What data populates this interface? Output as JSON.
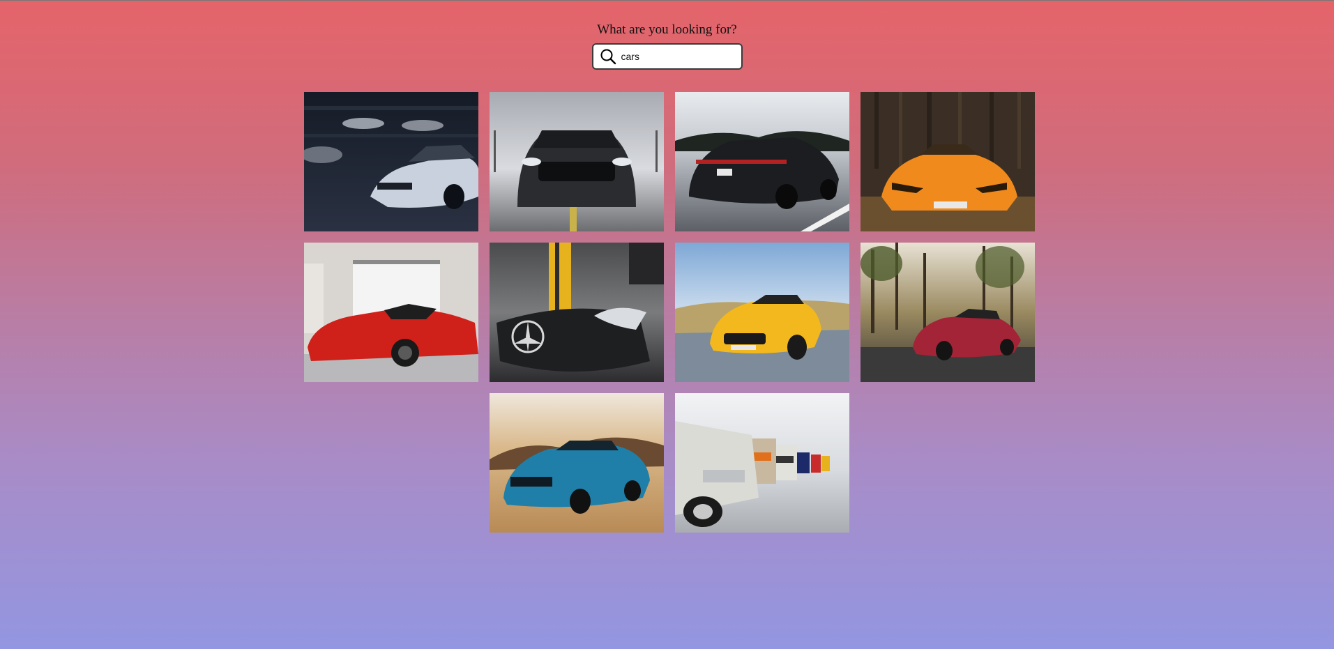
{
  "search": {
    "prompt": "What are you looking for?",
    "value": "cars",
    "icon": "search-icon"
  },
  "results": [
    {
      "subject": "silver-camaro-garage",
      "colors": {
        "bg": "#1e2533",
        "car": "#c9d1de"
      }
    },
    {
      "subject": "black-mustang-front",
      "colors": {
        "bg": "#b9bcc4",
        "car": "#2a2c30"
      }
    },
    {
      "subject": "black-porsche-road",
      "colors": {
        "bg": "#c7ccd2",
        "car": "#1c1d20"
      }
    },
    {
      "subject": "orange-lamborghini-forest",
      "colors": {
        "bg": "#3b2f25",
        "car": "#f08a1c"
      }
    },
    {
      "subject": "red-ferrari-showroom",
      "colors": {
        "bg": "#d9d6d2",
        "car": "#d0201a"
      }
    },
    {
      "subject": "grey-mercedes-hood",
      "colors": {
        "bg": "#3a3a3c",
        "car": "#6d6e70"
      }
    },
    {
      "subject": "yellow-amg-road",
      "colors": {
        "bg": "#8fb4da",
        "car": "#f2b81d"
      }
    },
    {
      "subject": "red-amg-forest",
      "colors": {
        "bg": "#8a7a55",
        "car": "#a32436"
      }
    },
    {
      "subject": "blue-camaro-desert",
      "colors": {
        "bg": "#c59a64",
        "car": "#1f7fa8"
      }
    },
    {
      "subject": "classic-bmw-row",
      "colors": {
        "bg": "#e3e6ea",
        "car": "#dadbd5"
      }
    }
  ]
}
